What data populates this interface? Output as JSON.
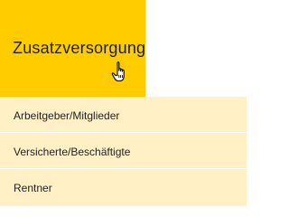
{
  "menu": {
    "main": {
      "label": "Zusatzversorgung",
      "cursor_icon": "hand-pointer-icon",
      "color": "#ffcc00"
    },
    "submenu_color": "#fff0c6",
    "items": [
      {
        "label": "Arbeitgeber/Mitglieder"
      },
      {
        "label": "Versicherte/Beschäftigte"
      },
      {
        "label": "Rentner"
      }
    ]
  }
}
